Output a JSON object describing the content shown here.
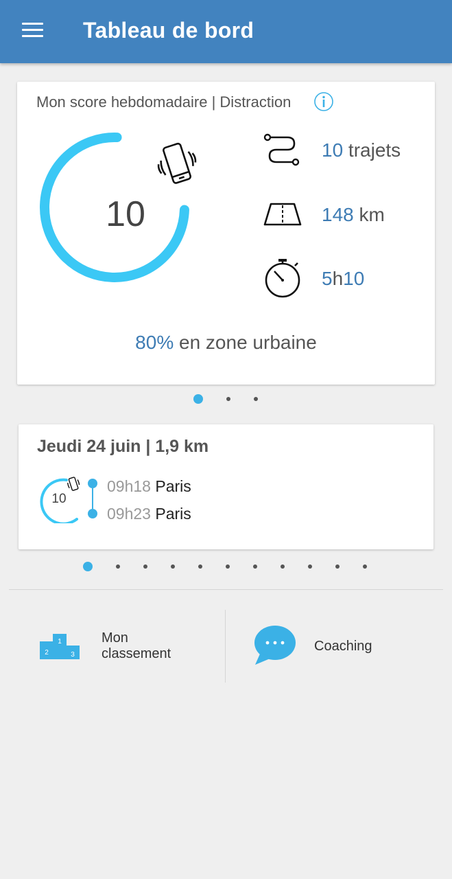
{
  "header": {
    "title": "Tableau de bord",
    "menu_icon": "hamburger-menu-icon"
  },
  "score_card": {
    "title": "Mon score hebdomadaire | Distraction",
    "info_icon": "info-icon",
    "score": "10",
    "score_progress_fraction": 0.75,
    "gauge_color": "#3bc8f5",
    "phone_icon": "vibrating-phone-icon",
    "stats": [
      {
        "icon": "route-icon",
        "value": "10",
        "unit": " trajets"
      },
      {
        "icon": "road-icon",
        "value": "148",
        "unit": " km"
      },
      {
        "icon": "stopwatch-icon",
        "value_a": "5",
        "value_b": "h",
        "value_c": "10"
      }
    ],
    "urban_percent": "80%",
    "urban_text": " en zone urbaine"
  },
  "score_pager": {
    "count": 3,
    "active": 0
  },
  "trip_card": {
    "title": "Jeudi 24 juin | 1,9 km",
    "score": "10",
    "start_time": "09h18",
    "start_city": "Paris",
    "end_time": "09h23",
    "end_city": "Paris"
  },
  "trip_pager": {
    "count": 11,
    "active": 0
  },
  "bottom_nav": {
    "ranking_line1": "Mon",
    "ranking_line2": "classement",
    "ranking_icon": "podium-icon",
    "ranking_podium": [
      "1",
      "2",
      "3"
    ],
    "coaching_label": "Coaching",
    "coaching_icon": "chat-bubble-icon"
  },
  "colors": {
    "appbar": "#4283bf",
    "accent_light_blue": "#3bb1e6",
    "value_blue": "#3e7cb4"
  }
}
